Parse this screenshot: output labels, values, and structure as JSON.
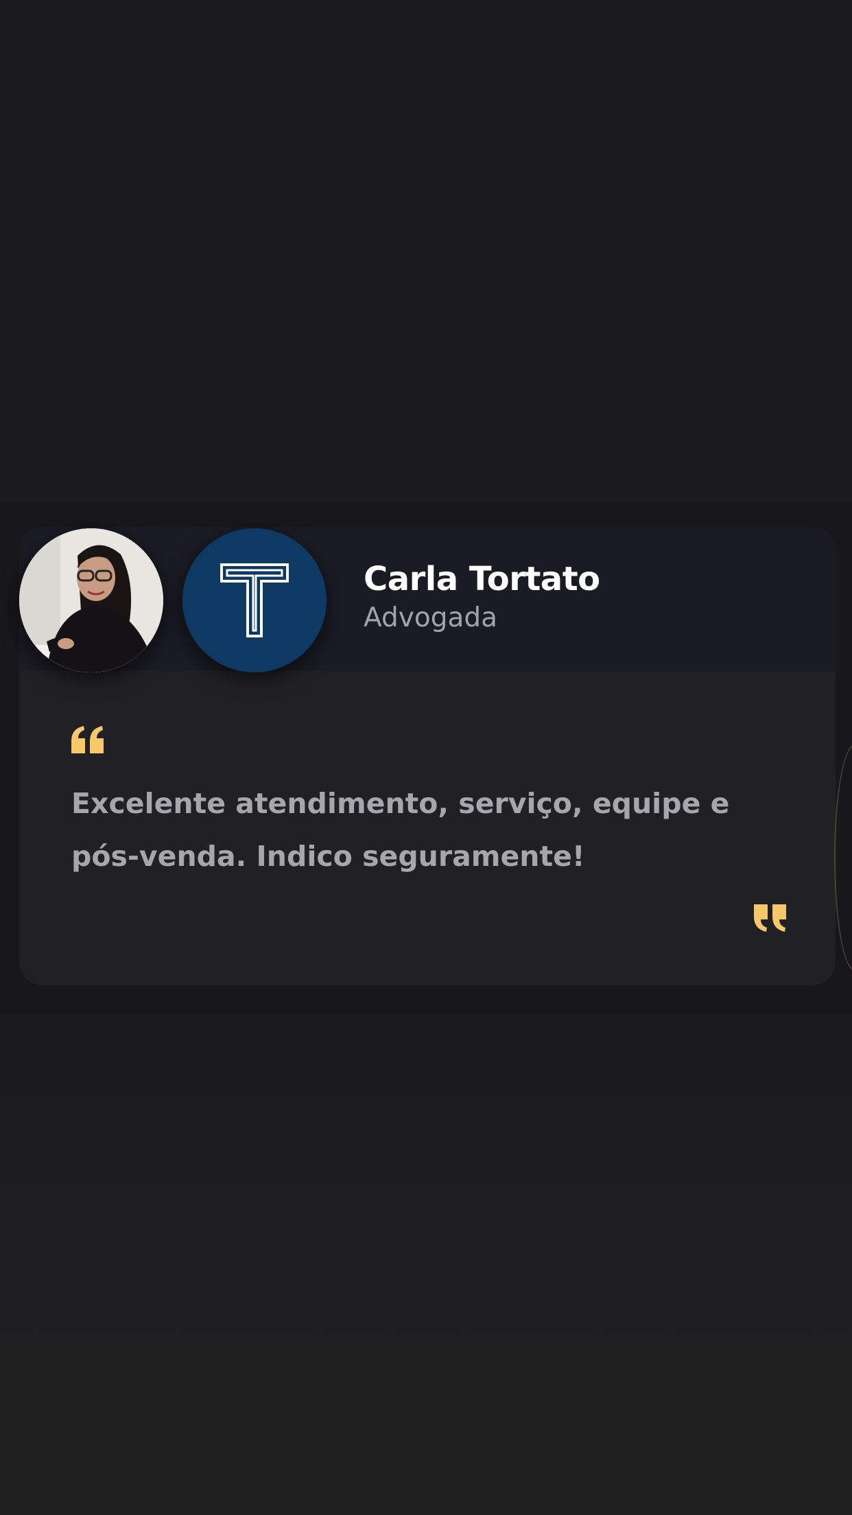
{
  "testimonial": {
    "name": "Carla Tortato",
    "role": "Advogada",
    "text": "Excelente atendimento, serviço, equipe e pós-venda. Indico seguramente!"
  },
  "icons": {
    "avatar": "person-photo",
    "company_logo": "letter-t-logo",
    "open_quote": "open-quote-icon",
    "close_quote": "close-quote-icon"
  },
  "colors": {
    "quote_accent": "#f6c86a",
    "company_logo_bg": "#0e3963",
    "card_bg": "#212025",
    "header_bg": "#1a1b23"
  }
}
